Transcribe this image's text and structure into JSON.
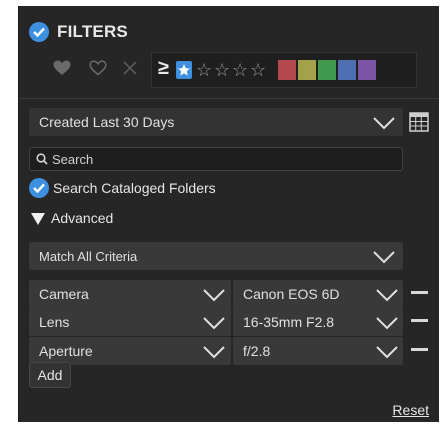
{
  "header": {
    "title": "FILTERS"
  },
  "rating": {
    "operator": "≥",
    "stars": 5,
    "selected": 1
  },
  "color_labels": [
    "#b5474f",
    "#a3a14a",
    "#3f9a4e",
    "#4d6fb2",
    "#7d54a6"
  ],
  "date_filter": {
    "value": "Created Last 30 Days"
  },
  "search": {
    "placeholder": "Search"
  },
  "search_cataloged": {
    "label": "Search Cataloged Folders",
    "checked": true
  },
  "advanced": {
    "label": "Advanced"
  },
  "match": {
    "value": "Match All Criteria"
  },
  "criteria": [
    {
      "field": "Camera",
      "value": "Canon EOS 6D"
    },
    {
      "field": "Lens",
      "value": "16-35mm F2.8"
    },
    {
      "field": "Aperture",
      "value": "f/2.8"
    }
  ],
  "add_label": "Add",
  "reset_label": "Reset"
}
